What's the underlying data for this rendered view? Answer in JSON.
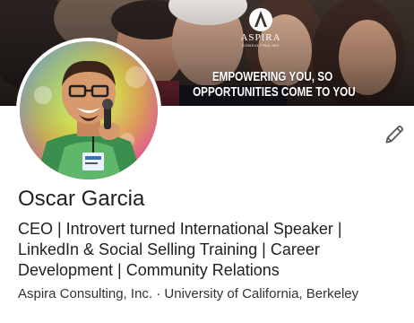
{
  "banner": {
    "brand_name": "ASPIRA",
    "brand_subtitle": "CONSULTING INC",
    "tagline_line1": "EMPOWERING YOU, SO",
    "tagline_line2": "OPPORTUNITIES COME TO YOU"
  },
  "profile": {
    "name": "Oscar Garcia",
    "headline": "CEO | Introvert turned International Speaker | LinkedIn & Social Selling Training | Career Development | Community Relations",
    "company_school": "Aspira Consulting, Inc. · University of California, Berkeley",
    "icons": {
      "edit": "pencil-icon"
    }
  }
}
